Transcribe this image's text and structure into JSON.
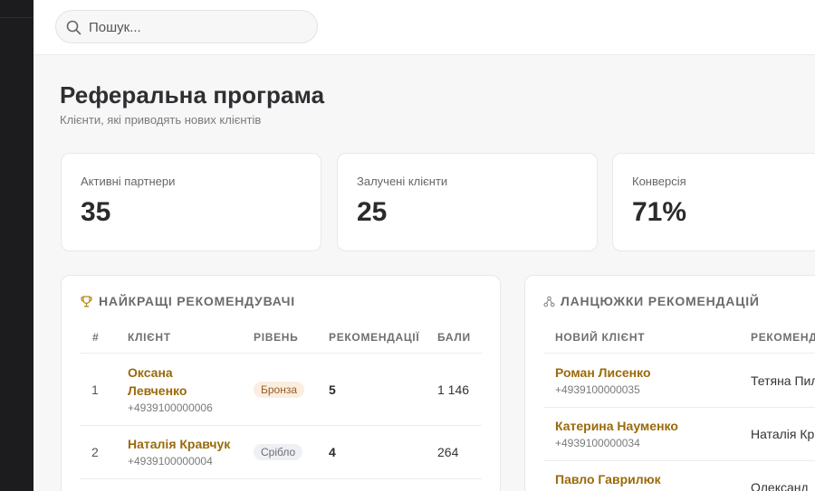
{
  "search": {
    "placeholder": "Пошук..."
  },
  "page": {
    "title": "Реферальна програма",
    "subtitle": "Клієнти, які приводять нових клієнтів"
  },
  "stats": [
    {
      "label": "Активні партнери",
      "value": "35"
    },
    {
      "label": "Залучені клієнти",
      "value": "25"
    },
    {
      "label": "Конверсія",
      "value": "71%"
    }
  ],
  "top_referrers": {
    "title": "НАЙКРАЩІ РЕКОМЕНДУВАЧІ",
    "icon": "trophy-icon",
    "columns": [
      "#",
      "КЛІЄНТ",
      "РІВЕНЬ",
      "РЕКОМЕНДАЦІЇ",
      "БАЛИ"
    ],
    "rows": [
      {
        "rank": "1",
        "name_line1": "Оксана",
        "name_line2": "Левченко",
        "phone": "+4939100000006",
        "level": "Бронза",
        "referrals": "5",
        "points": "1 146"
      },
      {
        "rank": "2",
        "name": "Наталія Кравчук",
        "phone": "+4939100000004",
        "level": "Срібло",
        "referrals": "4",
        "points": "264"
      }
    ]
  },
  "chains": {
    "title": "ЛАНЦЮЖКИ РЕКОМЕНДАЦІЙ",
    "icon": "network-icon",
    "columns": [
      "НОВИЙ КЛІЄНТ",
      "РЕКОМЕНД"
    ],
    "rows": [
      {
        "name": "Роман Лисенко",
        "phone": "+4939100000035",
        "referrer": "Тетяна Пил"
      },
      {
        "name": "Катерина Науменко",
        "phone": "+4939100000034",
        "referrer": "Наталія Кр"
      },
      {
        "name": "Павло Гаврилюк",
        "referrer": "Олександ"
      }
    ]
  },
  "colors": {
    "accent": "#9a6a0b",
    "bronze_bg": "#fbeee0",
    "bronze_text": "#9a5a22",
    "silver_bg": "#eef0f3",
    "silver_text": "#6b6f76",
    "sidebar": "#1c1c1e"
  }
}
